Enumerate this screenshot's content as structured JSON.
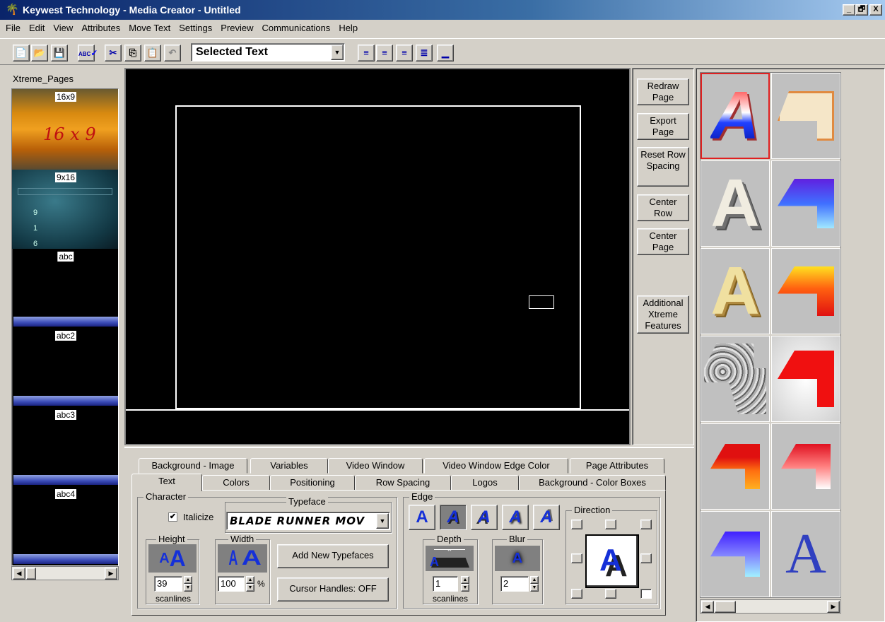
{
  "window": {
    "title": "Keywest Technology - Media Creator - Untitled",
    "controls": [
      "_",
      "🗗",
      "X"
    ]
  },
  "menu": [
    "File",
    "Edit",
    "View",
    "Attributes",
    "Move Text",
    "Settings",
    "Preview",
    "Communications",
    "Help"
  ],
  "toolbar": {
    "text_select": "Selected Text",
    "spell_label": "ABC"
  },
  "pages": {
    "title": "Xtreme_Pages",
    "items": [
      {
        "label": "16x9",
        "art": "16 x 9"
      },
      {
        "label": "9x16",
        "art": "9 16"
      },
      {
        "label": "abc"
      },
      {
        "label": "abc2"
      },
      {
        "label": "abc3"
      },
      {
        "label": "abc4"
      }
    ]
  },
  "side_buttons": [
    "Redraw Page",
    "Export Page",
    "Reset Row Spacing",
    "Center Row",
    "Center Page",
    "Additional Xtreme Features"
  ],
  "tabs": {
    "row1": [
      "Background - Image",
      "Variables",
      "Video Window",
      "Video Window Edge Color",
      "Page Attributes"
    ],
    "row2": [
      "Text",
      "Colors",
      "Positioning",
      "Row Spacing",
      "Logos",
      "Background - Color Boxes"
    ],
    "active": "Text"
  },
  "character": {
    "group_label": "Character",
    "italicize_label": "Italicize",
    "italicize_checked": true,
    "typeface_label": "Typeface",
    "typeface_value": "BLADE RUNNER MOV",
    "height_label": "Height",
    "height_value": "39",
    "height_unit": "scanlines",
    "width_label": "Width",
    "width_value": "100",
    "width_unit": "%",
    "add_typefaces": "Add New Typefaces",
    "cursor_handles": "Cursor Handles: OFF"
  },
  "edge": {
    "group_label": "Edge",
    "depth_label": "Depth",
    "depth_value": "1",
    "depth_unit": "scanlines",
    "blur_label": "Blur",
    "blur_value": "2",
    "direction_label": "Direction"
  },
  "colors": {
    "titlebar_start": "#0a246a",
    "titlebar_end": "#a6caf0",
    "face": "#d4d0c8",
    "accent_blue": "#1530d8",
    "selected_border": "#e02020"
  }
}
